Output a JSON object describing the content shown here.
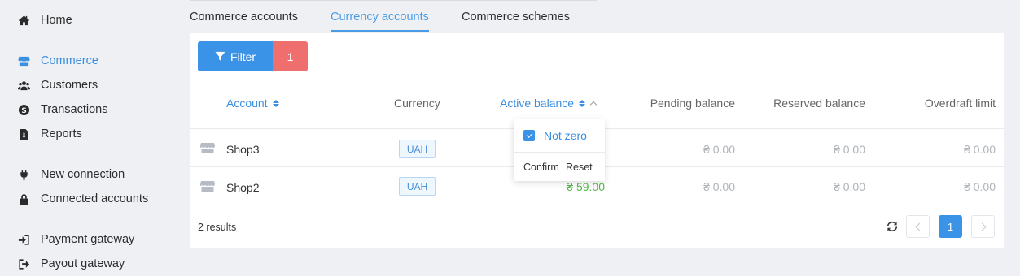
{
  "sidebar": {
    "items": [
      {
        "label": "Home",
        "icon": "home-icon"
      },
      {
        "label": "Commerce",
        "icon": "store-icon",
        "active": true
      },
      {
        "label": "Customers",
        "icon": "users-icon"
      },
      {
        "label": "Transactions",
        "icon": "dollar-icon"
      },
      {
        "label": "Reports",
        "icon": "file-download-icon"
      },
      {
        "label": "New connection",
        "icon": "plug-icon"
      },
      {
        "label": "Connected accounts",
        "icon": "lock-icon"
      },
      {
        "label": "Payment gateway",
        "icon": "sign-in-icon"
      },
      {
        "label": "Payout gateway",
        "icon": "sign-out-icon"
      }
    ]
  },
  "tabs": [
    {
      "label": "Commerce accounts"
    },
    {
      "label": "Currency accounts",
      "active": true
    },
    {
      "label": "Commerce schemes"
    }
  ],
  "filter": {
    "label": "Filter",
    "count": "1"
  },
  "table": {
    "headers": {
      "account": "Account",
      "currency": "Currency",
      "active_balance": "Active balance",
      "pending_balance": "Pending balance",
      "reserved_balance": "Reserved balance",
      "overdraft_limit": "Overdraft limit"
    },
    "rows": [
      {
        "account": "Shop3",
        "currency": "UAH",
        "active_balance": "",
        "pending_balance": "₴ 0.00",
        "reserved_balance": "₴ 0.00",
        "overdraft_limit": "₴ 0.00"
      },
      {
        "account": "Shop2",
        "currency": "UAH",
        "active_balance": "₴ 59.00",
        "pending_balance": "₴ 0.00",
        "reserved_balance": "₴ 0.00",
        "overdraft_limit": "₴ 0.00"
      }
    ]
  },
  "dropdown": {
    "option": "Not zero",
    "checked": true,
    "confirm": "Confirm",
    "reset": "Reset"
  },
  "footer": {
    "results": "2 results",
    "page": "1"
  },
  "colors": {
    "accent": "#3a93e6",
    "danger": "#ef6f6f",
    "positive": "#54b948"
  }
}
